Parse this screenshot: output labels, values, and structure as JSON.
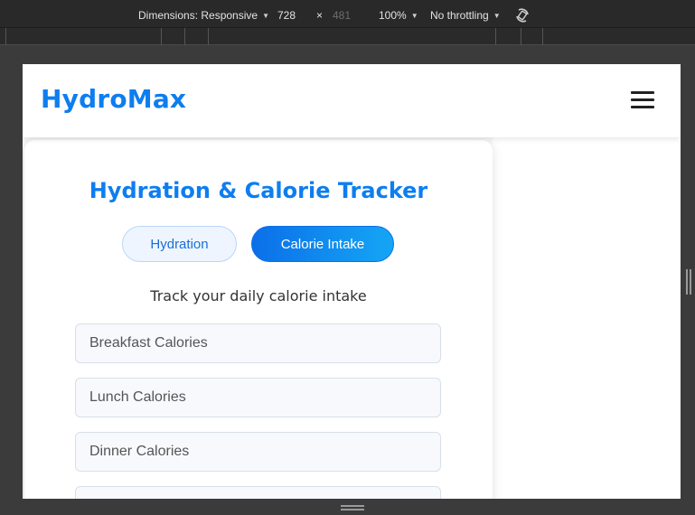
{
  "devtools": {
    "dimensions_label": "Dimensions: Responsive",
    "width": "728",
    "times": "×",
    "height": "481",
    "zoom": "100%",
    "throttling": "No throttling"
  },
  "nav": {
    "logo": "HydroMax"
  },
  "tracker": {
    "title": "Hydration & Calorie Tracker",
    "tabs": [
      {
        "label": "Hydration",
        "active": false
      },
      {
        "label": "Calorie Intake",
        "active": true
      }
    ],
    "subtitle": "Track your daily calorie intake",
    "fields": [
      {
        "placeholder": "Breakfast Calories"
      },
      {
        "placeholder": "Lunch Calories"
      },
      {
        "placeholder": "Dinner Calories"
      }
    ]
  },
  "colors": {
    "brand": "#0d7ef0",
    "active_tab_start": "#0b6fe8",
    "active_tab_end": "#15a6f5"
  }
}
